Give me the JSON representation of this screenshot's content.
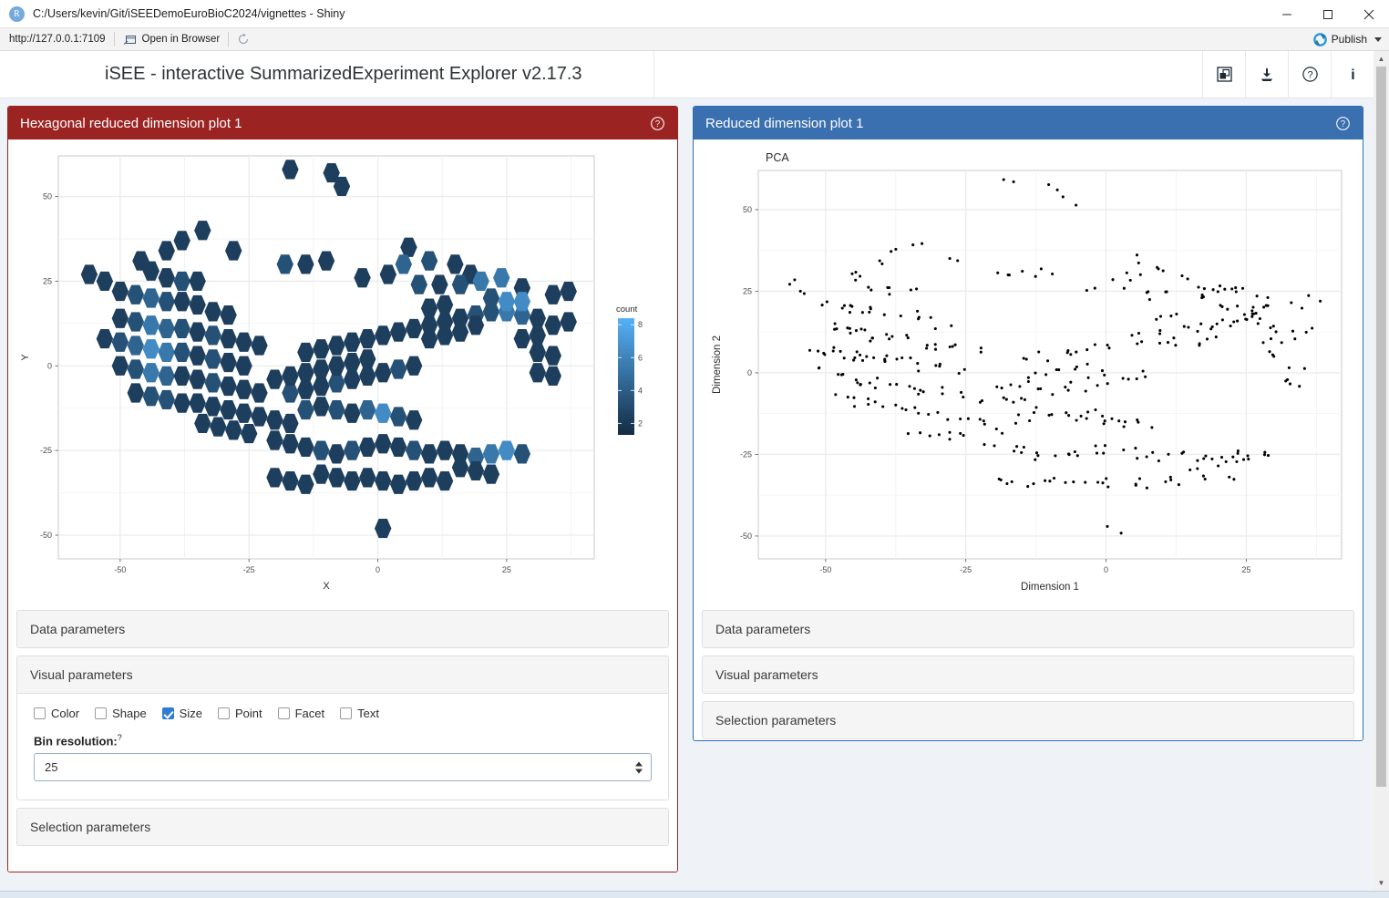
{
  "window": {
    "title": "C:/Users/kevin/Git/iSEEDemoEuroBioC2024/vignettes - Shiny",
    "logo_letter": "R",
    "minimize": "—",
    "maximize": "☐",
    "close": "✕"
  },
  "urlbar": {
    "url": "http://127.0.0.1:7109",
    "open_in_browser": "Open in Browser",
    "reload_icon": "reload-icon",
    "publish_label": "Publish"
  },
  "app": {
    "title": "iSEE - interactive SummarizedExperiment Explorer v2.17.3",
    "header_icons": [
      {
        "name": "organize-panels-icon"
      },
      {
        "name": "download-icon"
      },
      {
        "name": "help-icon"
      },
      {
        "name": "info-icon"
      }
    ]
  },
  "left_panel": {
    "title": "Hexagonal reduced dimension plot 1",
    "accent": "#9b2423",
    "help_icon": "help-circle-icon",
    "sections": [
      {
        "label": "Data parameters",
        "open": false
      },
      {
        "label": "Visual parameters",
        "open": true
      },
      {
        "label": "Selection parameters",
        "open": false
      }
    ],
    "visual_parameters": {
      "checkboxes": [
        {
          "label": "Color",
          "checked": false
        },
        {
          "label": "Shape",
          "checked": false
        },
        {
          "label": "Size",
          "checked": true
        },
        {
          "label": "Point",
          "checked": false
        },
        {
          "label": "Facet",
          "checked": false
        },
        {
          "label": "Text",
          "checked": false
        }
      ],
      "bin_resolution_label": "Bin resolution:",
      "bin_resolution_help": "?",
      "bin_resolution_value": "25"
    }
  },
  "right_panel": {
    "title": "Reduced dimension plot 1",
    "accent": "#3a6fb0",
    "help_icon": "help-circle-icon",
    "sections": [
      {
        "label": "Data parameters",
        "open": false
      },
      {
        "label": "Visual parameters",
        "open": false
      },
      {
        "label": "Selection parameters",
        "open": false
      }
    ]
  },
  "chart_data": [
    {
      "type": "heatmap",
      "subtype": "hexbin",
      "title": "",
      "xlabel": "X",
      "ylabel": "Y",
      "xlim": [
        -62,
        42
      ],
      "ylim": [
        -57,
        62
      ],
      "xticks": [
        -50,
        -25,
        0,
        25
      ],
      "yticks": [
        -50,
        -25,
        0,
        25,
        50
      ],
      "grid": true,
      "legend": {
        "title": "count",
        "position": "right",
        "ticks": [
          2,
          4,
          6,
          8
        ],
        "low_color": "#132b43",
        "high_color": "#56b1f7"
      },
      "bin_resolution": 25,
      "bins": [
        [
          -17,
          58,
          2
        ],
        [
          -9,
          57,
          2
        ],
        [
          -7,
          53,
          2
        ],
        [
          -34,
          40,
          2
        ],
        [
          -38,
          37,
          2
        ],
        [
          -41,
          34,
          2
        ],
        [
          -28,
          34,
          2
        ],
        [
          6,
          35,
          2
        ],
        [
          -18,
          30,
          3
        ],
        [
          -14,
          30,
          2
        ],
        [
          -10,
          31,
          2
        ],
        [
          5,
          30,
          4
        ],
        [
          10,
          31,
          3
        ],
        [
          15,
          30,
          2
        ],
        [
          2,
          27,
          2
        ],
        [
          -3,
          26,
          2
        ],
        [
          18,
          27,
          2
        ],
        [
          24,
          26,
          5
        ],
        [
          20,
          25,
          5
        ],
        [
          16,
          24,
          3
        ],
        [
          12,
          24,
          2
        ],
        [
          8,
          24,
          3
        ],
        [
          28,
          23,
          2
        ],
        [
          -46,
          31,
          2
        ],
        [
          -44,
          28,
          2
        ],
        [
          -41,
          26,
          2
        ],
        [
          -38,
          25,
          3
        ],
        [
          -35,
          25,
          2
        ],
        [
          -50,
          22,
          2
        ],
        [
          -47,
          21,
          3
        ],
        [
          -44,
          20,
          4
        ],
        [
          -41,
          19,
          3
        ],
        [
          -38,
          19,
          2
        ],
        [
          -35,
          18,
          2
        ],
        [
          -32,
          16,
          2
        ],
        [
          -29,
          15,
          2
        ],
        [
          -50,
          14,
          2
        ],
        [
          -47,
          13,
          3
        ],
        [
          -44,
          12,
          5
        ],
        [
          -41,
          11,
          4
        ],
        [
          -38,
          11,
          3
        ],
        [
          -35,
          10,
          2
        ],
        [
          -32,
          9,
          3
        ],
        [
          -29,
          8,
          2
        ],
        [
          -26,
          7,
          2
        ],
        [
          -23,
          6,
          2
        ],
        [
          -53,
          8,
          2
        ],
        [
          -50,
          7,
          3
        ],
        [
          -47,
          6,
          4
        ],
        [
          -44,
          5,
          6
        ],
        [
          -41,
          4,
          5
        ],
        [
          -38,
          4,
          3
        ],
        [
          -35,
          3,
          2
        ],
        [
          -32,
          2,
          3
        ],
        [
          -29,
          1,
          2
        ],
        [
          -26,
          0,
          2
        ],
        [
          -50,
          0,
          2
        ],
        [
          -47,
          -1,
          3
        ],
        [
          -44,
          -2,
          5
        ],
        [
          -41,
          -3,
          4
        ],
        [
          -38,
          -3,
          2
        ],
        [
          -35,
          -4,
          2
        ],
        [
          -32,
          -5,
          3
        ],
        [
          -29,
          -6,
          2
        ],
        [
          -26,
          -7,
          2
        ],
        [
          -23,
          -8,
          2
        ],
        [
          -47,
          -8,
          2
        ],
        [
          -44,
          -9,
          3
        ],
        [
          -41,
          -10,
          3
        ],
        [
          -38,
          -11,
          2
        ],
        [
          -35,
          -11,
          2
        ],
        [
          -32,
          -12,
          2
        ],
        [
          -29,
          -13,
          2
        ],
        [
          -26,
          -14,
          2
        ],
        [
          -23,
          -15,
          2
        ],
        [
          -20,
          -16,
          2
        ],
        [
          -17,
          -17,
          2
        ],
        [
          -14,
          -13,
          3
        ],
        [
          -11,
          -12,
          2
        ],
        [
          -8,
          -13,
          3
        ],
        [
          -5,
          -14,
          2
        ],
        [
          -2,
          -13,
          4
        ],
        [
          1,
          -14,
          6
        ],
        [
          4,
          -15,
          3
        ],
        [
          7,
          -16,
          2
        ],
        [
          -17,
          -8,
          3
        ],
        [
          -14,
          -7,
          2
        ],
        [
          -11,
          -6,
          2
        ],
        [
          -8,
          -5,
          3
        ],
        [
          -5,
          -4,
          2
        ],
        [
          -2,
          -3,
          2
        ],
        [
          1,
          -2,
          2
        ],
        [
          4,
          -1,
          3
        ],
        [
          7,
          0,
          2
        ],
        [
          -20,
          -4,
          2
        ],
        [
          -17,
          -3,
          2
        ],
        [
          -14,
          -2,
          2
        ],
        [
          -11,
          -1,
          2
        ],
        [
          -8,
          0,
          2
        ],
        [
          -5,
          1,
          2
        ],
        [
          -2,
          2,
          2
        ],
        [
          -14,
          4,
          2
        ],
        [
          -11,
          5,
          2
        ],
        [
          -8,
          6,
          2
        ],
        [
          -5,
          7,
          2
        ],
        [
          -2,
          8,
          2
        ],
        [
          1,
          9,
          2
        ],
        [
          4,
          10,
          2
        ],
        [
          7,
          11,
          2
        ],
        [
          10,
          12,
          2
        ],
        [
          13,
          13,
          2
        ],
        [
          16,
          14,
          2
        ],
        [
          19,
          15,
          3
        ],
        [
          22,
          16,
          3
        ],
        [
          25,
          16,
          5
        ],
        [
          28,
          15,
          4
        ],
        [
          31,
          14,
          2
        ],
        [
          25,
          19,
          6
        ],
        [
          28,
          19,
          6
        ],
        [
          22,
          20,
          3
        ],
        [
          19,
          12,
          2
        ],
        [
          16,
          10,
          2
        ],
        [
          13,
          9,
          2
        ],
        [
          10,
          8,
          2
        ],
        [
          -20,
          -22,
          2
        ],
        [
          -17,
          -23,
          2
        ],
        [
          -14,
          -24,
          2
        ],
        [
          -11,
          -25,
          3
        ],
        [
          -8,
          -26,
          2
        ],
        [
          -5,
          -25,
          3
        ],
        [
          -2,
          -24,
          2
        ],
        [
          1,
          -23,
          2
        ],
        [
          4,
          -24,
          2
        ],
        [
          7,
          -25,
          3
        ],
        [
          10,
          -26,
          2
        ],
        [
          13,
          -25,
          2
        ],
        [
          16,
          -26,
          2
        ],
        [
          19,
          -27,
          4
        ],
        [
          22,
          -26,
          5
        ],
        [
          25,
          -25,
          6
        ],
        [
          28,
          -26,
          3
        ],
        [
          16,
          -30,
          2
        ],
        [
          19,
          -31,
          2
        ],
        [
          22,
          -32,
          2
        ],
        [
          -11,
          -32,
          2
        ],
        [
          -8,
          -33,
          2
        ],
        [
          -5,
          -34,
          2
        ],
        [
          -2,
          -33,
          2
        ],
        [
          1,
          -34,
          2
        ],
        [
          4,
          -35,
          2
        ],
        [
          7,
          -34,
          2
        ],
        [
          10,
          -33,
          2
        ],
        [
          13,
          -34,
          2
        ],
        [
          -20,
          -33,
          2
        ],
        [
          -17,
          -34,
          2
        ],
        [
          -14,
          -35,
          2
        ],
        [
          1,
          -48,
          2
        ],
        [
          -34,
          -17,
          2
        ],
        [
          -31,
          -18,
          2
        ],
        [
          -28,
          -19,
          2
        ],
        [
          -25,
          -20,
          2
        ],
        [
          31,
          4,
          2
        ],
        [
          34,
          3,
          2
        ],
        [
          31,
          -2,
          2
        ],
        [
          34,
          -3,
          2
        ],
        [
          28,
          8,
          2
        ],
        [
          31,
          9,
          2
        ],
        [
          34,
          12,
          2
        ],
        [
          37,
          13,
          2
        ],
        [
          37,
          22,
          2
        ],
        [
          34,
          21,
          2
        ],
        [
          -53,
          25,
          2
        ],
        [
          -56,
          27,
          2
        ],
        [
          13,
          18,
          2
        ],
        [
          10,
          17,
          2
        ]
      ]
    },
    {
      "type": "scatter",
      "title": "PCA",
      "xlabel": "Dimension 1",
      "ylabel": "Dimension 2",
      "xlim": [
        -62,
        42
      ],
      "ylim": [
        -57,
        62
      ],
      "xticks": [
        -50,
        -25,
        0,
        25
      ],
      "yticks": [
        -50,
        -25,
        0,
        25,
        50
      ],
      "grid": true,
      "point_color": "#000000",
      "point_size": 1.4,
      "n_points": 379
    }
  ]
}
